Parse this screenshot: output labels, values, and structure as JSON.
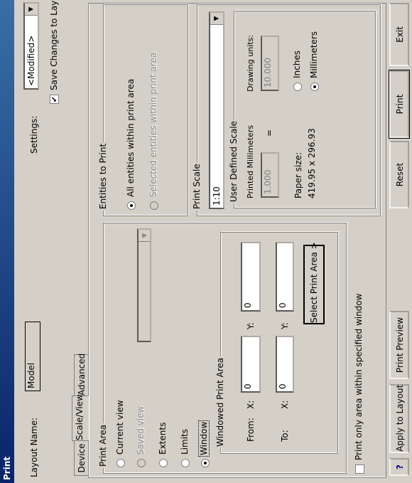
{
  "window": {
    "title": "Print"
  },
  "top": {
    "layout_label": "Layout Name:",
    "layout_value": "Model",
    "settings_label": "Settings:",
    "settings_value": "<Modified>",
    "save_changes_label": "Save Changes to Layout",
    "save_changes_checked": true
  },
  "tabs": [
    "Device",
    "Scale/View",
    "Advanced"
  ],
  "print_area": {
    "title": "Print Area",
    "options": [
      "Current view",
      "Saved view",
      "Extents",
      "Limits",
      "Window"
    ],
    "selected": "Window",
    "saved_view_value": ""
  },
  "windowed": {
    "title": "Windowed Print Area",
    "from_label": "From:",
    "to_label": "To:",
    "x_label": "X:",
    "y_label": "Y:",
    "from_x": "0",
    "from_y": "0",
    "to_x": "0",
    "to_y": "0",
    "select_button": "Select Print Area  >"
  },
  "print_only_label": "Print only area within specified window",
  "entities": {
    "title": "Entities to Print",
    "all_label": "All entities within print area",
    "selected_label": "Selected entities within print area"
  },
  "scale": {
    "title": "Print Scale",
    "value": "1:10",
    "user_group_title": "User Defined Scale",
    "printed_label": "Printed Millimeters",
    "drawing_label": "Drawing units:",
    "printed_value": "1.000",
    "equals": "=",
    "drawing_value": "10.000",
    "paper_size_label": "Paper size:",
    "paper_size_value": "419.95 x 296.93",
    "inches_label": "Inches",
    "millimeters_label": "Millimeters",
    "units_selected": "Millimeters"
  },
  "buttons": {
    "help": "?",
    "apply": "Apply to Layout",
    "preview": "Print Preview",
    "reset": "Reset",
    "print": "Print",
    "exit": "Exit"
  }
}
